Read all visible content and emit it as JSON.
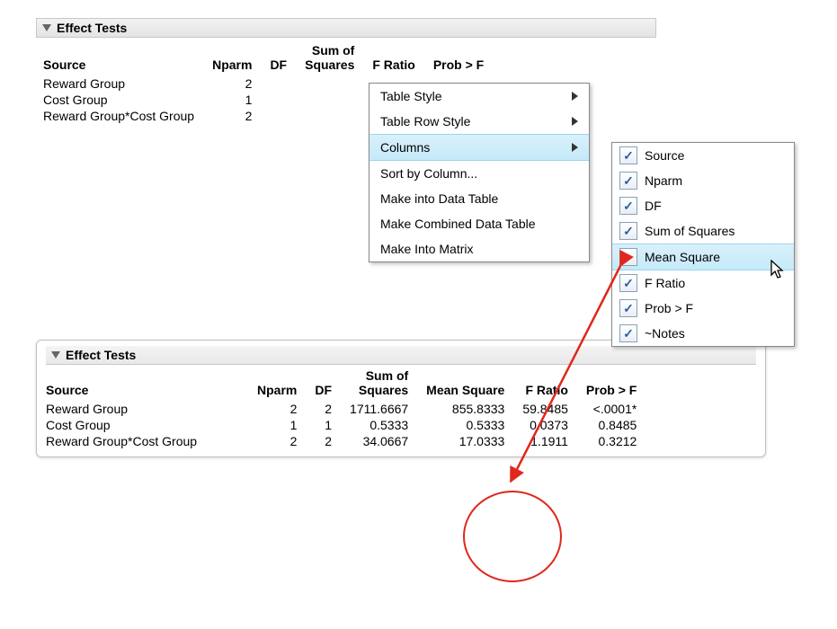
{
  "colors": {
    "menu_highlight": "#c5e9f9",
    "annotation": "#e1261c"
  },
  "top_panel": {
    "title": "Effect Tests",
    "col_headers": {
      "source": "Source",
      "nparm": "Nparm",
      "df": "DF",
      "sum_sq": "Sum of\nSquares",
      "fratio": "F Ratio",
      "probf": "Prob > F"
    },
    "rows": [
      {
        "source": "Reward Group",
        "nparm": "2"
      },
      {
        "source": "Cost Group",
        "nparm": "1"
      },
      {
        "source": "Reward Group*Cost Group",
        "nparm": "2"
      }
    ]
  },
  "context_menu": {
    "items": [
      {
        "label": "Table Style",
        "has_submenu": true
      },
      {
        "label": "Table Row Style",
        "has_submenu": true
      },
      {
        "label": "Columns",
        "has_submenu": true,
        "highlighted": true
      },
      {
        "label": "Sort by Column..."
      },
      {
        "label": "Make into Data Table"
      },
      {
        "label": "Make Combined Data Table"
      },
      {
        "label": "Make Into Matrix"
      }
    ]
  },
  "columns_submenu": {
    "items": [
      {
        "label": "Source",
        "checked": true
      },
      {
        "label": "Nparm",
        "checked": true
      },
      {
        "label": "DF",
        "checked": true
      },
      {
        "label": "Sum of Squares",
        "checked": true
      },
      {
        "label": "Mean Square",
        "checked": false,
        "hovered": true
      },
      {
        "label": "F Ratio",
        "checked": true
      },
      {
        "label": "Prob > F",
        "checked": true
      },
      {
        "label": "~Notes",
        "checked": true
      }
    ]
  },
  "bottom_panel": {
    "title": "Effect Tests",
    "col_headers": {
      "source": "Source",
      "nparm": "Nparm",
      "df": "DF",
      "sum_sq": "Sum of\nSquares",
      "mean_sq": "Mean Square",
      "fratio": "F Ratio",
      "probf": "Prob > F"
    },
    "rows": [
      {
        "source": "Reward Group",
        "nparm": "2",
        "df": "2",
        "sum_sq": "1711.6667",
        "mean_sq": "855.8333",
        "fratio": "59.8485",
        "probf": "<.0001*"
      },
      {
        "source": "Cost Group",
        "nparm": "1",
        "df": "1",
        "sum_sq": "0.5333",
        "mean_sq": "0.5333",
        "fratio": "0.0373",
        "probf": "0.8485"
      },
      {
        "source": "Reward Group*Cost Group",
        "nparm": "2",
        "df": "2",
        "sum_sq": "34.0667",
        "mean_sq": "17.0333",
        "fratio": "1.1911",
        "probf": "0.3212"
      }
    ]
  }
}
